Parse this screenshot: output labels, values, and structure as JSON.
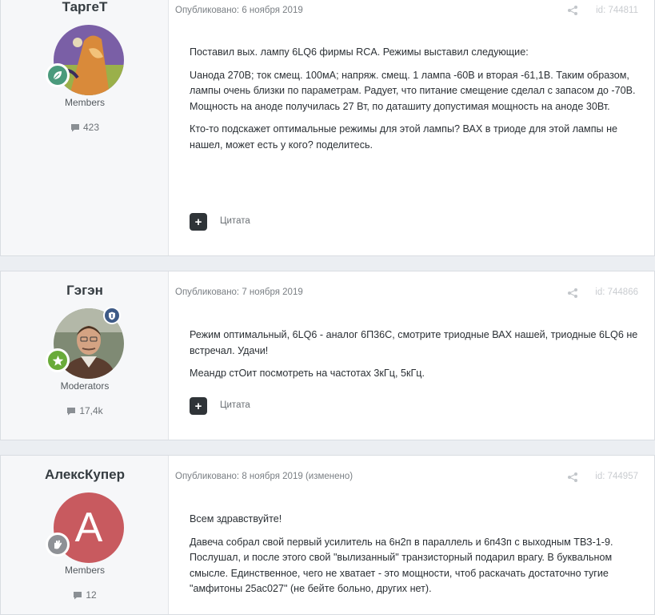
{
  "posts": [
    {
      "author": "ТаргеТ",
      "group": "Members",
      "count": "423",
      "published": "Опубликовано: 6 ноября 2019",
      "id": "id: 744811",
      "paragraphs": [
        "Поставил вых. лампу 6LQ6 фирмы RCA. Режимы выставил следующие:",
        "Uанода 270В;  ток смещ.  100мА; напряж. смещ. 1 лампа -60В и вторая -61,1В. Таким образом, лампы очень близки по параметрам. Радует, что питание смещение сделал с запасом до -70В. Мощность на аноде получилась 27 Вт, по даташиту допустимая мощность на аноде 30Вт.",
        "Кто-то подскажет оптимальные режимы для этой лампы? ВАХ в триоде для этой лампы не нашел, может есть у кого? поделитесь."
      ],
      "quote": "Цитата"
    },
    {
      "author": "Гэгэн",
      "group": "Moderators",
      "count": "17,4k",
      "published": "Опубликовано: 7 ноября 2019",
      "id": "id: 744866",
      "paragraphs": [
        "Режим оптимальный,  6LQ6 - аналог  6П36С,  смотрите  триодные ВАХ нашей, триодные 6LQ6 не встречал.   Удачи!",
        "Меандр стОит посмотреть на частотах 3кГц, 5кГц."
      ],
      "quote": "Цитата"
    },
    {
      "author": "АлексКупер",
      "group": "Members",
      "count": "12",
      "avatar_letter": "A",
      "published": "Опубликовано: 8 ноября 2019 (изменено)",
      "id": "id: 744957",
      "paragraphs": [
        "Всем здравствуйте!",
        "Давеча собрал свой первый усилитель на 6н2п в параллель и 6п43п с выходным ТВЗ-1-9. Послушал, и после этого свой \"вылизанный\" транзисторный подарил врагу. В буквальном смысле. Единственное, чего не хватает - это мощности, чтоб раскачать достаточно тугие \"амфитоны 25ас027\" (не бейте больно, других нет)."
      ]
    }
  ],
  "colors": {
    "leaf_badge": "#4a9a7c",
    "star_badge": "#6aab3a",
    "hand_badge": "#8e9196",
    "letter_avatar": "#c85a5f",
    "mod_shield": "#3e5a86"
  },
  "icons": [
    "comment-icon",
    "share-icon",
    "plus-icon",
    "leaf-icon",
    "star-icon",
    "hand-icon",
    "shield-icon"
  ]
}
